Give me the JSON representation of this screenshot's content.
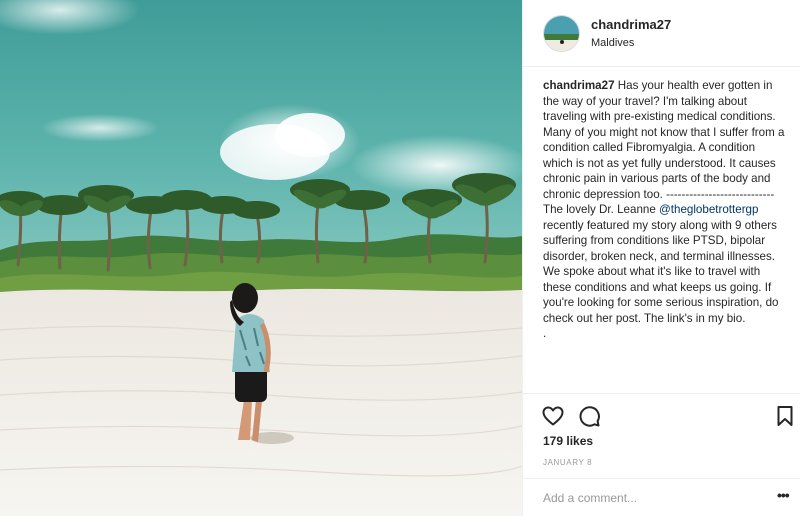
{
  "post": {
    "username": "chandrima27",
    "location": "Maldives",
    "photo_alt": "",
    "caption": {
      "username": "chandrima27",
      "paragraphs": [
        "Has your health ever gotten in the way of your travel? I'm talking about traveling with pre-existing medical conditions.",
        "Many of you might not know that I suffer from a condition called Fibromyalgia. A condition which is not as yet fully understood. It causes chronic pain in various parts of the body and chronic depression too. ----------------------------"
      ],
      "p3_before": "The lovely Dr. Leanne ",
      "p3_mention": "@theglobetrottergp",
      "p3_after": " recently featured my story along with 9 others suffering from conditions like PTSD, bipolar disorder, broken neck, and terminal illnesses. We spoke about what it's like to travel with these conditions and what keeps us going. If you're looking for some serious inspiration, do check out her post. The link's in my bio.",
      "trailing": "."
    },
    "likes": "179 likes",
    "date": "JANUARY 8",
    "comment_placeholder": "Add a comment...",
    "more_label": "•••"
  },
  "icons": {
    "like": "heart-outline-icon",
    "comment": "speech-bubble-icon",
    "save": "bookmark-icon",
    "more": "ellipsis-icon"
  },
  "colors": {
    "text": "#262626",
    "secondary": "#999999",
    "mention": "#003569",
    "border": "#efefef"
  }
}
